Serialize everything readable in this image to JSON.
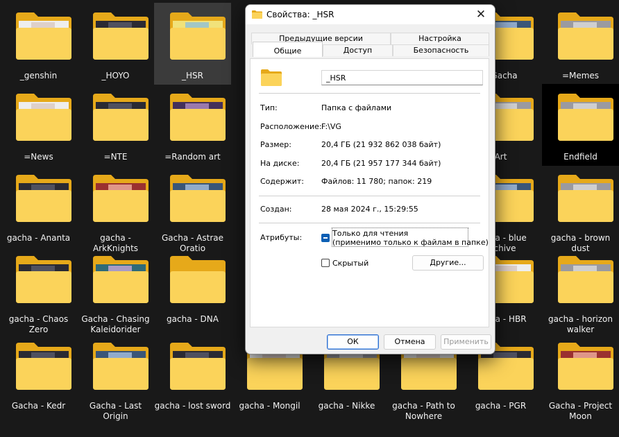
{
  "folders": [
    {
      "label": "_genshin",
      "thumb": "light"
    },
    {
      "label": "_HOYO",
      "thumb": "dark"
    },
    {
      "label": "_HSR",
      "thumb": "yellow",
      "selected": true
    },
    {
      "label": "",
      "thumb": "light"
    },
    {
      "label": "",
      "thumb": "dark"
    },
    {
      "label": "",
      "thumb": "pink"
    },
    {
      "label": "=Gacha",
      "thumb": "blue"
    },
    {
      "label": "=Memes",
      "thumb": "gray"
    },
    {
      "label": "=News",
      "thumb": "light"
    },
    {
      "label": "=NTE",
      "thumb": "dark"
    },
    {
      "label": "=Random art",
      "thumb": "purple"
    },
    {
      "label": "",
      "thumb": "blue"
    },
    {
      "label": "",
      "thumb": "gray"
    },
    {
      "label": "",
      "thumb": "dark"
    },
    {
      "label": "Art",
      "thumb": "gray"
    },
    {
      "label": "Endfield",
      "thumb": "gray",
      "dark": true
    },
    {
      "label": "gacha - Ananta",
      "thumb": "dark"
    },
    {
      "label": "gacha - ArkKnights",
      "thumb": "red"
    },
    {
      "label": "Gacha - Astrae Oratio",
      "thumb": "blue"
    },
    {
      "label": "",
      "thumb": "dark"
    },
    {
      "label": "",
      "thumb": "blue"
    },
    {
      "label": "",
      "thumb": "light"
    },
    {
      "label": "gacha - blue archive",
      "thumb": "blue"
    },
    {
      "label": "gacha - brown dust",
      "thumb": "gray"
    },
    {
      "label": "gacha - Chaos Zero",
      "thumb": "dark"
    },
    {
      "label": "Gacha - Chasing Kaleidorider",
      "thumb": "teal"
    },
    {
      "label": "gacha - DNA",
      "thumb": "none"
    },
    {
      "label": "",
      "thumb": "gray"
    },
    {
      "label": "",
      "thumb": "dark"
    },
    {
      "label": "",
      "thumb": "pink"
    },
    {
      "label": "gacha - HBR",
      "thumb": "light"
    },
    {
      "label": "gacha - horizon walker",
      "thumb": "gray"
    },
    {
      "label": "Gacha - Kedr",
      "thumb": "dark"
    },
    {
      "label": "Gacha - Last Origin",
      "thumb": "blue"
    },
    {
      "label": "gacha - lost sword",
      "thumb": "dark"
    },
    {
      "label": "gacha - Mongil",
      "thumb": "light"
    },
    {
      "label": "gacha - Nikke",
      "thumb": "gray"
    },
    {
      "label": "gacha - Path to Nowhere",
      "thumb": "light"
    },
    {
      "label": "gacha - PGR",
      "thumb": "dark"
    },
    {
      "label": "Gacha - Project Moon",
      "thumb": "red"
    }
  ],
  "dialog": {
    "title": "Свойства: _HSR",
    "close_glyph": "✕",
    "tabs_row1": [
      "Предыдущие версии",
      "Настройка"
    ],
    "tabs_row2": [
      "Общие",
      "Доступ",
      "Безопасность"
    ],
    "active_tab": "Общие",
    "folder_name": "_HSR",
    "fields": [
      {
        "label": "Тип:",
        "value": "Папка с файлами"
      },
      {
        "label": "Расположение:",
        "value": "F:\\VG"
      },
      {
        "label": "Размер:",
        "value": "20,4 ГБ (21 932 862 038 байт)"
      },
      {
        "label": "На диске:",
        "value": "20,4 ГБ (21 957 177 344 байт)"
      },
      {
        "label": "Содержит:",
        "value": "Файлов: 11 780; папок: 219"
      }
    ],
    "created": {
      "label": "Создан:",
      "value": "28 мая 2024 г., 15:29:55"
    },
    "attributes_label": "Атрибуты:",
    "readonly_line1": "Только для чтения",
    "readonly_line2": "(применимо только к файлам в папке)",
    "hidden_label": "Скрытый",
    "other_button": "Другие...",
    "ok_button": "ОК",
    "cancel_button": "Отмена",
    "apply_button": "Применить"
  },
  "colors": {
    "folder_back": "#e6a91a",
    "folder_front": "#fbd35a",
    "accent": "#0a5fb4"
  }
}
